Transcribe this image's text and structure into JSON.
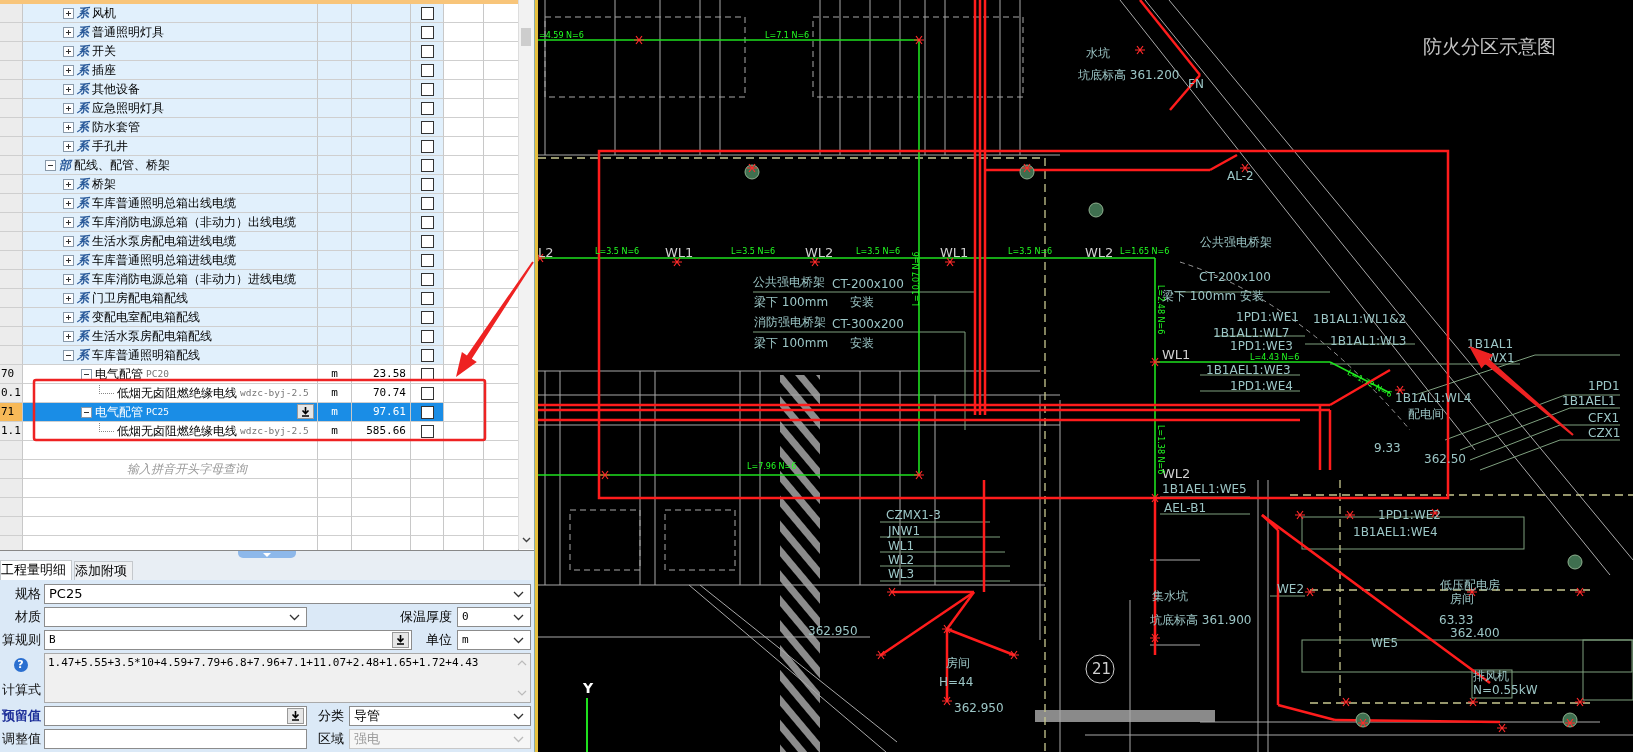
{
  "tree_table": {
    "partial_branch": [
      {
        "tag": "系",
        "name": "风机",
        "expanded": false,
        "checked": false,
        "selected": false
      },
      {
        "tag": "系",
        "name": "普通照明灯具",
        "expanded": false,
        "checked": false,
        "selected": false
      },
      {
        "tag": "系",
        "name": "开关",
        "expanded": false,
        "checked": false,
        "selected": false
      },
      {
        "tag": "系",
        "name": "插座",
        "expanded": false,
        "checked": false,
        "selected": false
      },
      {
        "tag": "系",
        "name": "其他设备",
        "expanded": false,
        "checked": false,
        "selected": false
      },
      {
        "tag": "系",
        "name": "应急照明灯具",
        "expanded": false,
        "checked": false,
        "selected": false
      },
      {
        "tag": "系",
        "name": "防水套管",
        "expanded": false,
        "checked": false,
        "selected": false
      },
      {
        "tag": "系",
        "name": "手孔井",
        "expanded": false,
        "checked": false,
        "selected": false
      }
    ],
    "items": [
      {
        "tag": "部",
        "name": "配线、配管、桥架",
        "expanded": true,
        "checked": false,
        "selected": false,
        "children": [
          {
            "tag": "系",
            "name": "桥架",
            "expanded": false,
            "checked": false,
            "selected": false
          },
          {
            "tag": "系",
            "name": "车库普通照明总箱出线电缆",
            "expanded": false,
            "checked": false,
            "selected": false
          },
          {
            "tag": "系",
            "name": "车库消防电源总箱（非动力）出线电缆",
            "expanded": false,
            "checked": false,
            "selected": false
          },
          {
            "tag": "系",
            "name": "生活水泵房配电箱进线电缆",
            "expanded": false,
            "checked": false,
            "selected": false
          },
          {
            "tag": "系",
            "name": "车库普通照明总箱进线电缆",
            "expanded": false,
            "checked": false,
            "selected": false
          },
          {
            "tag": "系",
            "name": "车库消防电源总箱（非动力）进线电缆",
            "expanded": false,
            "checked": false,
            "selected": false
          },
          {
            "tag": "系",
            "name": "门卫房配电箱配线",
            "expanded": false,
            "checked": false,
            "selected": false
          },
          {
            "tag": "系",
            "name": "变配电室配电箱配线",
            "expanded": false,
            "checked": false,
            "selected": false
          },
          {
            "tag": "系",
            "name": "生活水泵房配电箱配线",
            "expanded": false,
            "checked": false,
            "selected": false
          },
          {
            "tag": "系",
            "name": "车库普通照明箱配线",
            "expanded": true,
            "checked": false,
            "selected": false,
            "children": [
              {
                "index": "70",
                "name": "电气配管",
                "spec": "PC20",
                "unit": "m",
                "quantity": "23.58",
                "expanded": true,
                "checked": false,
                "selected": false,
                "children": [
                  {
                    "index": "0.1",
                    "name": "低烟无卤阻燃绝缘电线",
                    "spec": "wdzc-byj-2.5",
                    "unit": "m",
                    "quantity": "70.74",
                    "checked": false,
                    "selected": false
                  }
                ]
              },
              {
                "index": "71",
                "name": "电气配管",
                "spec": "PC25",
                "unit": "m",
                "quantity": "97.61",
                "expanded": true,
                "checked": false,
                "selected": true,
                "children": [
                  {
                    "index": "1.1",
                    "name": "低烟无卤阻燃绝缘电线",
                    "spec": "wdzc-byj-2.5",
                    "unit": "m",
                    "quantity": "585.66",
                    "checked": false,
                    "selected": false
                  }
                ]
              }
            ]
          }
        ]
      }
    ],
    "search_hint": "输入拼音开头字母查询"
  },
  "detail_tabs": [
    {
      "label": "工程量明细",
      "selected": true
    },
    {
      "label": "添加附项",
      "selected": false
    }
  ],
  "form": {
    "spec": {
      "label": "规格",
      "value": "PC25"
    },
    "material": {
      "label": "材质"
    },
    "insulation_thickness": {
      "label": "保温厚度",
      "value": "0"
    },
    "calc_rule": {
      "label": "算规则",
      "value": "B"
    },
    "unit": {
      "label": "单位",
      "value": "m"
    },
    "formula": {
      "label": "计算式",
      "help_glyph": "?",
      "value": "1.47+5.55+3.5*10+4.59+7.79+6.8+7.96+7.1+11.07+2.48+1.65+1.72+4.43"
    },
    "reserved": {
      "label": "预留值"
    },
    "category": {
      "label": "分类",
      "value": "导管"
    },
    "adjustment": {
      "label": "调整值"
    },
    "region": {
      "label": "区域",
      "value": "强电",
      "disabled": true
    }
  },
  "cad": {
    "labels": [
      {
        "text": "=4.59 N=6",
        "kind": "wire"
      },
      {
        "text": "L=7.1 N=6",
        "kind": "wire"
      },
      {
        "text": "水坑",
        "kind": "note"
      },
      {
        "text": "坑底标高 361.200",
        "kind": "note"
      },
      {
        "text": "防火分区示意图",
        "kind": "title"
      },
      {
        "text": "FN",
        "kind": "note"
      },
      {
        "text": "AL-2",
        "kind": "note"
      },
      {
        "text": "公共强电桥架",
        "kind": "note"
      },
      {
        "text": "CT-200x100",
        "kind": "note"
      },
      {
        "text": "梁下 100mm",
        "kind": "note"
      },
      {
        "text": "安装",
        "kind": "note"
      },
      {
        "text": "1PD1:WE1",
        "kind": "note"
      },
      {
        "text": "1B1AL1:WL1&2",
        "kind": "note"
      },
      {
        "text": "1B1AL1:WL7",
        "kind": "note"
      },
      {
        "text": "1B1AL1:WL3",
        "kind": "note"
      },
      {
        "text": "1PD1:WE3",
        "kind": "note"
      },
      {
        "text": "1B1AEL1:WE3",
        "kind": "note"
      },
      {
        "text": "1PD1:WE4",
        "kind": "note"
      },
      {
        "text": "1B1AL1:WL4",
        "kind": "note"
      },
      {
        "text": "配电间",
        "kind": "note"
      },
      {
        "text": "9.33",
        "kind": "note"
      },
      {
        "text": "362.50",
        "kind": "note"
      },
      {
        "text": "1B1AL1",
        "kind": "note"
      },
      {
        "text": "WX1",
        "kind": "note"
      },
      {
        "text": "1PD1",
        "kind": "note"
      },
      {
        "text": "1B1AEL1",
        "kind": "note"
      },
      {
        "text": "CFX1",
        "kind": "note"
      },
      {
        "text": "CZX1",
        "kind": "note"
      },
      {
        "text": "WL2",
        "kind": "tag"
      },
      {
        "text": "1B1AEL1:WE5",
        "kind": "note"
      },
      {
        "text": "L2",
        "kind": "tag"
      },
      {
        "text": "L=3.5 N=6",
        "kind": "wire"
      },
      {
        "text": "WL1",
        "kind": "tag"
      },
      {
        "text": "L=3.5 N=6",
        "kind": "wire"
      },
      {
        "text": "WL2",
        "kind": "tag"
      },
      {
        "text": "L=3.5 N=6",
        "kind": "wire"
      },
      {
        "text": "WL1",
        "kind": "tag"
      },
      {
        "text": "L=3.5 N=6",
        "kind": "wire"
      },
      {
        "text": "WL2",
        "kind": "tag"
      },
      {
        "text": "L=1.65 N=6",
        "kind": "wire"
      },
      {
        "text": "WL1",
        "kind": "tag"
      },
      {
        "text": "公共强电桥架",
        "kind": "note"
      },
      {
        "text": "CT-200x100",
        "kind": "note"
      },
      {
        "text": "梁下 100mm",
        "kind": "note"
      },
      {
        "text": "安装",
        "kind": "note"
      },
      {
        "text": "消防强电桥架",
        "kind": "note"
      },
      {
        "text": "CT-300x200",
        "kind": "note"
      },
      {
        "text": "梁下 100mm",
        "kind": "note"
      },
      {
        "text": "安装",
        "kind": "note"
      },
      {
        "text": "L=10.07 N=6",
        "kind": "wire"
      },
      {
        "text": "L=2.48 N=6",
        "kind": "wire"
      },
      {
        "text": "L=4.43 N=6",
        "kind": "wire"
      },
      {
        "text": "L=1.72 N=6",
        "kind": "wire"
      },
      {
        "text": "L=7.96 N=6",
        "kind": "wire"
      },
      {
        "text": "L=1.38 N=6",
        "kind": "wire"
      },
      {
        "text": "CZMX1-3",
        "kind": "note"
      },
      {
        "text": "JNW1",
        "kind": "note"
      },
      {
        "text": "WL1",
        "kind": "note"
      },
      {
        "text": "WL2",
        "kind": "note"
      },
      {
        "text": "WL3",
        "kind": "note"
      },
      {
        "text": "362.950",
        "kind": "note"
      },
      {
        "text": "房间",
        "kind": "note"
      },
      {
        "text": "H=44",
        "kind": "note"
      },
      {
        "text": "362.950",
        "kind": "note"
      },
      {
        "text": "AEL-B1",
        "kind": "note"
      },
      {
        "text": "集水坑",
        "kind": "note"
      },
      {
        "text": "坑底标高 361.900",
        "kind": "note"
      },
      {
        "text": "21",
        "kind": "grid-axis"
      },
      {
        "text": "WE2",
        "kind": "note"
      },
      {
        "text": "1PD1:WE2",
        "kind": "note"
      },
      {
        "text": "1B1AEL1:WE4",
        "kind": "note"
      },
      {
        "text": "低压配电房",
        "kind": "note"
      },
      {
        "text": "房间",
        "kind": "note"
      },
      {
        "text": "63.33",
        "kind": "note"
      },
      {
        "text": "362.400",
        "kind": "note"
      },
      {
        "text": "WE5",
        "kind": "note"
      },
      {
        "text": "排风机",
        "kind": "note"
      },
      {
        "text": "N=0.55kW",
        "kind": "note"
      },
      {
        "text": "Y",
        "kind": "axis"
      }
    ]
  }
}
